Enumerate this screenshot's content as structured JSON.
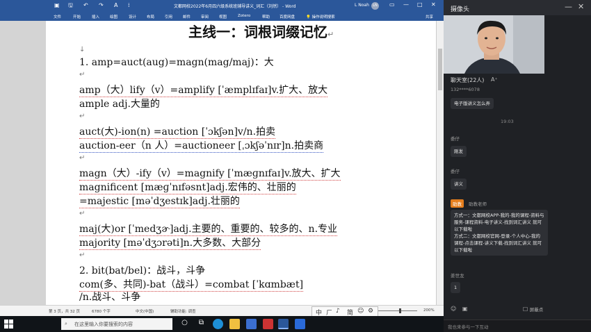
{
  "word": {
    "title": "文都网校2022年6月四六级系统班辅导讲义_词汇（刘然） - Word",
    "user": "L Noah",
    "user_initials": "LN",
    "share": "共享",
    "tell_me": "操作说明搜索",
    "ribbon_tabs": [
      "文件",
      "开始",
      "插入",
      "绘图",
      "设计",
      "布局",
      "引用",
      "邮件",
      "审阅",
      "视图",
      "Zotero",
      "帮助",
      "百度网盘"
    ],
    "status": {
      "page": "第 3 页，共 32 页",
      "words": "6780 个字",
      "lang": "中文(中国)",
      "accessibility": "辅助功能: 调查",
      "zoom": "200%"
    },
    "ime": [
      "中",
      "ㄏ",
      "♪",
      "简",
      "☺",
      "⚙"
    ]
  },
  "doc": {
    "heading": "主线一：词根词缀记忆",
    "mark": "↵",
    "arrow": "↓",
    "lines": [
      "1. amp=auct(aug)=magn(mag/maj)：大",
      "amp（大）lify（v）=amplify [ˈæmplɪfaɪ]v.扩大、放大",
      "ample adj.大量的",
      "auct(大)-ion(n) =auction [ˈɔkʃən]v/n.拍卖",
      "auction-eer（n 人）=auctioneer [ˌɔkʃəˈnɪr]n.拍卖商",
      "magn（大）-ify（v）=magnify [ˈmæɡnɪfaɪ]v.放大、扩大",
      "magnificent [mæɡˈnɪfəsnt]adj.宏伟的、壮丽的",
      "=majestic [məˈdʒestɪk]adj.壮丽的",
      "maj(大)or [ˈmedʒɚ]adj.主要的、重要的、较多的、n.专业",
      "majority [məˈdʒɔrəti]n.大多数、大部分",
      "2. bit(bat/bel)：战斗，斗争",
      "com(多、共同)-bat（战斗）=combat [ˈkɑmbæt]",
      "/n.战斗、斗争"
    ]
  },
  "panel": {
    "title": "摄像头",
    "min": "—",
    "close": "✕",
    "chat_title": "聊天室(22人)",
    "font_btn": "A⁺",
    "messages": [
      {
        "user": "132****6078",
        "text": "电子版讲义怎么弄"
      },
      {
        "user": "委仔",
        "text": "刚发"
      },
      {
        "user": "委仔",
        "text": "讲义"
      },
      {
        "user": "姜世龙",
        "text": "1"
      }
    ],
    "time": "19:03",
    "assistant_badge": "助教",
    "assistant_name": "助教老师",
    "assistant_msg": "方式一：文都网校APP-我的-我的课程-资料与服务-课程资料-电子讲义-找到词汇讲义 就可以下载啦\n方式二：文都网校官网-登录-个人中心-我的课程-点击课程-讲义下载-找到词汇讲义 就可以下载啦",
    "shield_label": "屏蔽点",
    "input_placeholder": "我也来参与一下互动"
  },
  "taskbar": {
    "search_placeholder": "在这里输入你要搜索的内容"
  }
}
